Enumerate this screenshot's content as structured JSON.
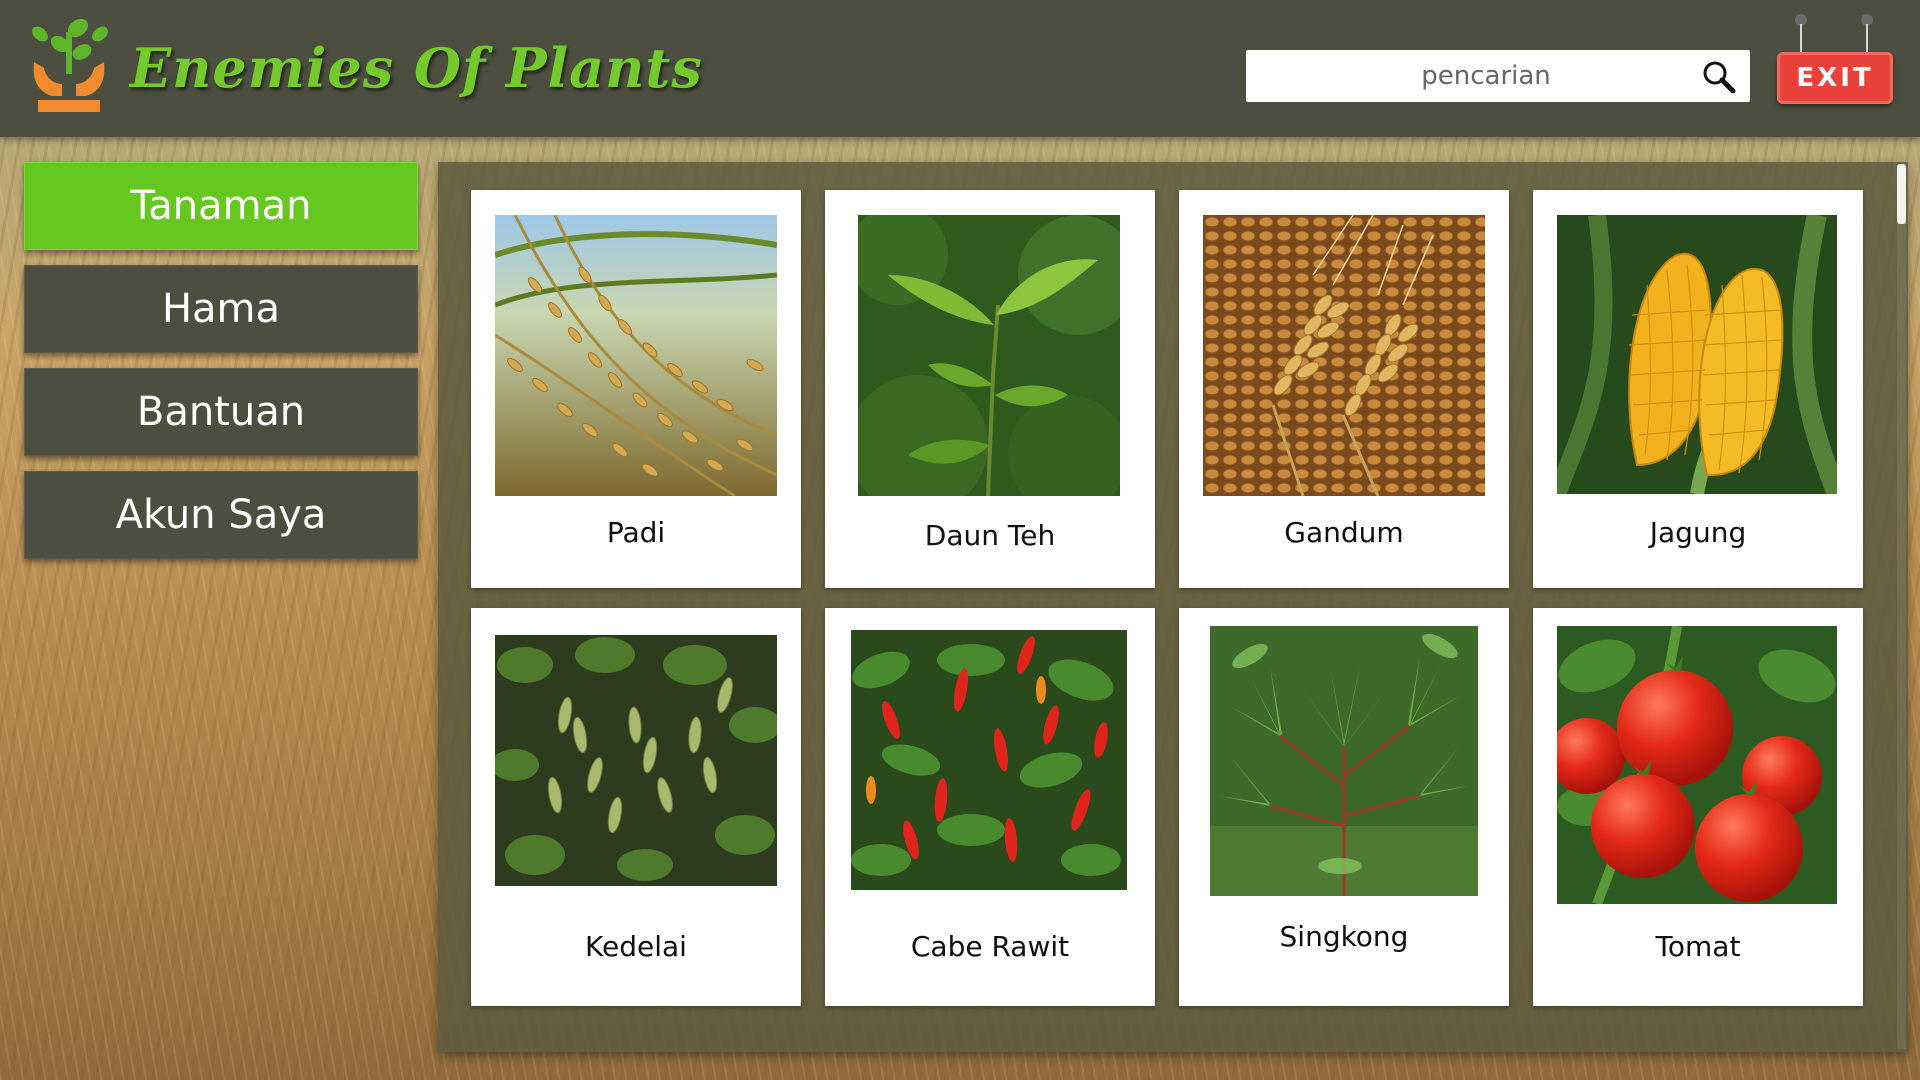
{
  "header": {
    "app_title": "Enemies Of Plants",
    "logo_icon": "plant-hands-logo-icon",
    "search": {
      "placeholder": "pencarian",
      "icon": "search-icon"
    },
    "exit_label": "EXIT"
  },
  "sidebar": {
    "items": [
      {
        "label": "Tanaman",
        "active": true
      },
      {
        "label": "Hama",
        "active": false
      },
      {
        "label": "Bantuan",
        "active": false
      },
      {
        "label": "Akun Saya",
        "active": false
      }
    ]
  },
  "plants": [
    {
      "label": "Padi",
      "photo": "rice-photo"
    },
    {
      "label": "Daun Teh",
      "photo": "tea-leaf-photo"
    },
    {
      "label": "Gandum",
      "photo": "wheat-photo"
    },
    {
      "label": "Jagung",
      "photo": "corn-photo"
    },
    {
      "label": "Kedelai",
      "photo": "soybean-photo"
    },
    {
      "label": "Cabe Rawit",
      "photo": "chili-photo"
    },
    {
      "label": "Singkong",
      "photo": "cassava-photo"
    },
    {
      "label": "Tomat",
      "photo": "tomato-photo"
    }
  ],
  "colors": {
    "header_bg": "#4c4f3f",
    "accent_green": "#66c81e",
    "title_green": "#74c92d",
    "exit_red": "#e8423a",
    "panel_bg": "#5c5a3e"
  }
}
